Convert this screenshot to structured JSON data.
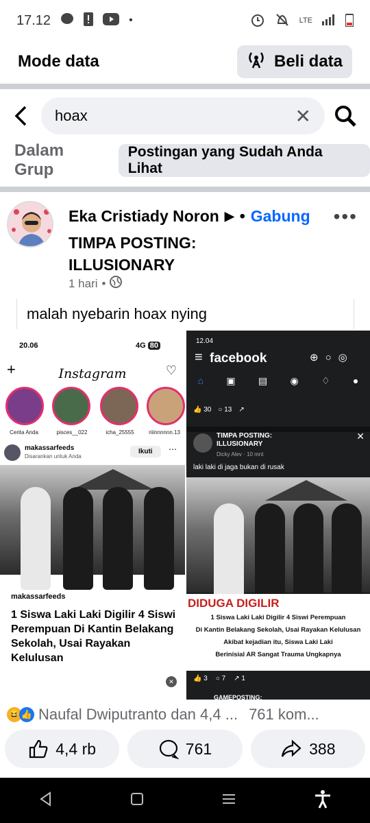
{
  "status": {
    "time": "17.12",
    "network": "LTE"
  },
  "header": {
    "title": "Mode data",
    "beli": "Beli data"
  },
  "search": {
    "value": "hoax"
  },
  "filters": {
    "in_group": "Dalam Grup",
    "seen": "Postingan yang Sudah Anda Lihat"
  },
  "post": {
    "author": "Eka Cristiady Noron",
    "join": "Gabung",
    "group": "TIMPA POSTING: ILLUSIONARY",
    "time": "1 hari",
    "caption": "malah nyebarin hoax nying"
  },
  "ig": {
    "time": "20.06",
    "signal": "4G",
    "battery": "80",
    "logo": "Instagram",
    "stories": [
      "Cerita Anda",
      "pisces__022",
      "icha_25555",
      "riiinnnnnn.13"
    ],
    "account": "makassarfeeds",
    "suggested": "Disarankan untuk Anda",
    "follow": "Ikuti",
    "brand": "makassarfeeds",
    "headline": "1 Siswa Laki Laki Digilir 4 Siswi Perempuan Di Kantin Belakang Sekolah, Usai Rayakan Kelulusan"
  },
  "fb": {
    "time": "12.04",
    "logo": "facebook",
    "likes": "30",
    "comments": "13",
    "group": "TIMPA POSTING: ILLUSIONARY",
    "poster": "Dicky Alev",
    "ago": "10 mnt",
    "caption": "laki laki di jaga bukan di rusak",
    "banner": "DIDUGA DIGILIR",
    "line1": "1 Siswa Laki Laki Digilir 4 Siswi Perempuan",
    "line2": "Di Kantin Belakang Sekolah, Usai Rayakan Kelulusan",
    "line3": "Akibat kejadian itu, Siswa Laki Laki",
    "line4": "Berinisial AR Sangat Trauma Ungkapnya",
    "r1": "3",
    "r2": "7",
    "r3": "1",
    "next": "GAMEPOSTING:"
  },
  "reactions": {
    "summary": "Naufal Dwiputranto dan 4,4 ...",
    "comments": "761 kom..."
  },
  "actions": {
    "like": "4,4 rb",
    "comment": "761",
    "share": "388"
  },
  "colors": {
    "accent": "#0866ff",
    "like_blue": "#1877f2",
    "haha": "#f7b125"
  }
}
